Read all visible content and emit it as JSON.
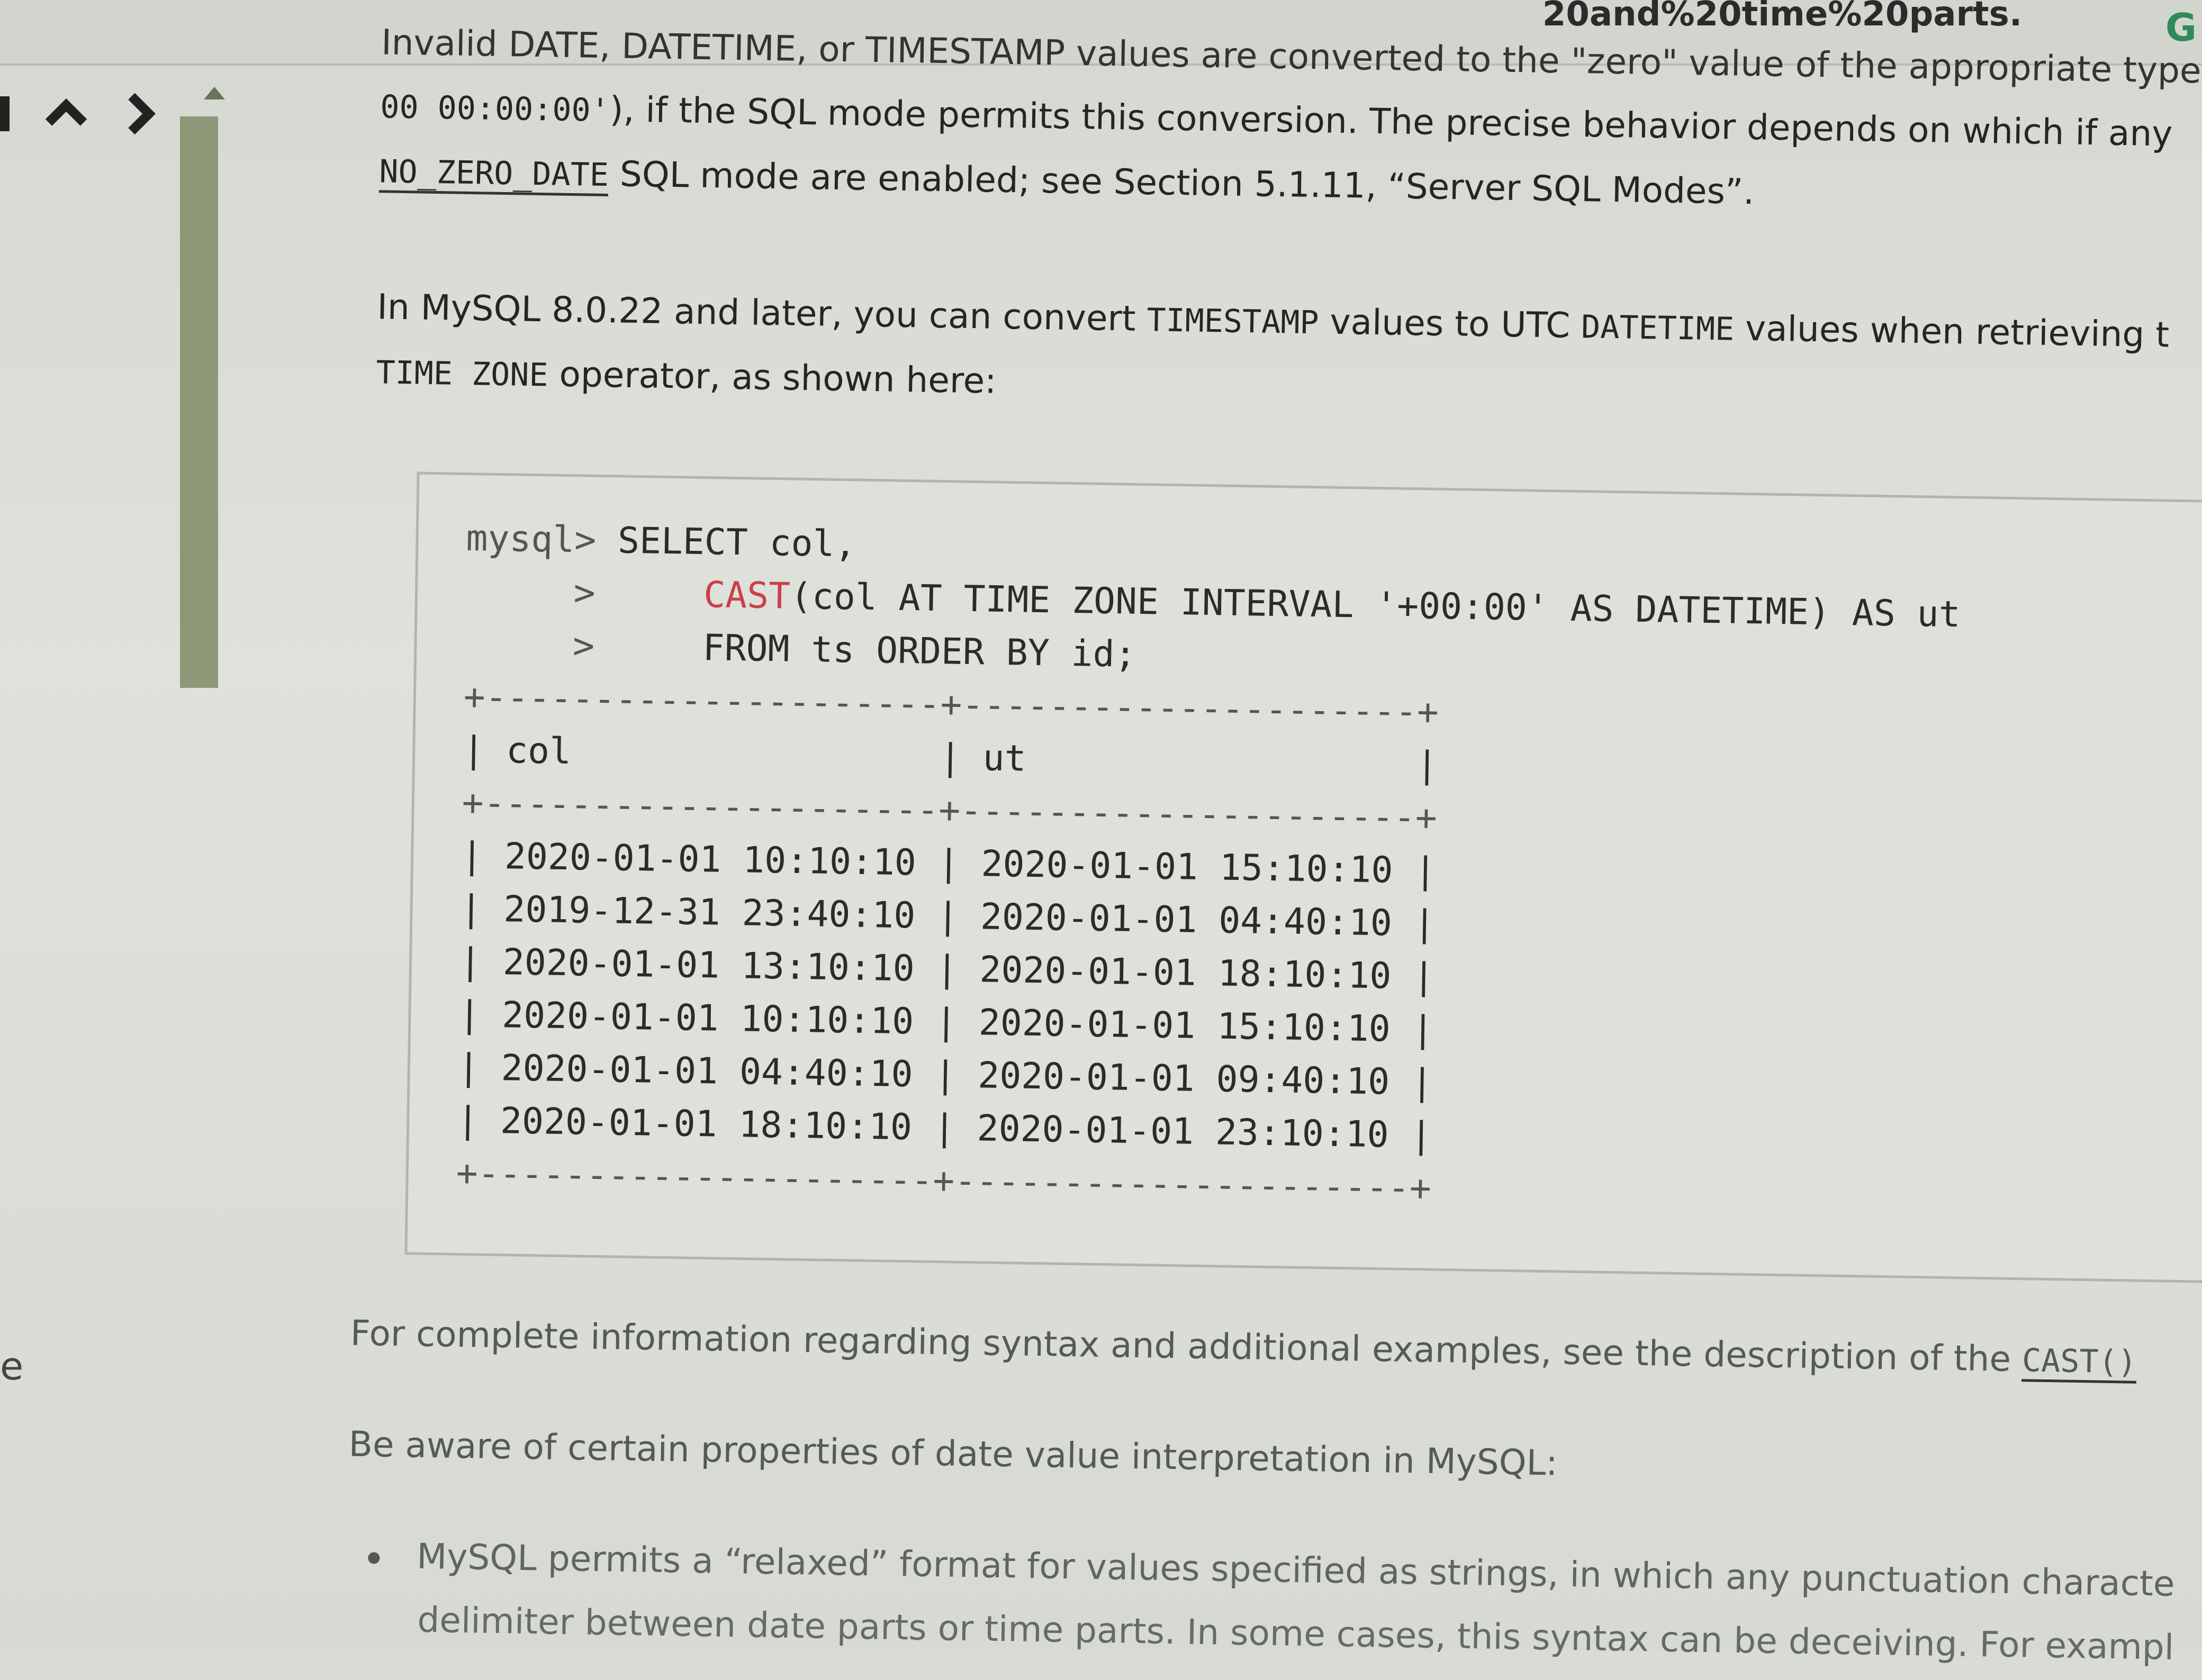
{
  "browser": {
    "url_fragment": "20and%20time%20parts.",
    "extension_label": "G"
  },
  "navigation": {
    "edge_label": "e"
  },
  "doc": {
    "para1_line1": "Invalid DATE, DATETIME, or TIMESTAMP values are converted to the \"zero\" value of the appropriate type (",
    "para1_line2_code": "00 00:00:00'",
    "para1_line2_text": "), if the SQL mode permits this conversion. The precise behavior depends on which if any",
    "para1_line3_link": "NO_ZERO_DATE",
    "para1_line3_text": " SQL mode are enabled; see Section 5.1.11, “Server SQL Modes”.",
    "para2_line1_a": "In MySQL 8.0.22 and later, you can convert ",
    "para2_line1_code1": "TIMESTAMP",
    "para2_line1_b": " values to UTC ",
    "para2_line1_code2": "DATETIME",
    "para2_line1_c": " values when retrieving t",
    "para2_line2_code": "TIME ZONE",
    "para2_line2_text": " operator, as shown here:",
    "code": {
      "prompt": "mysql>",
      "line1": " SELECT col,",
      "cont": "     >     ",
      "cast_kw": "CAST",
      "line2_rest": "(col AT TIME ZONE INTERVAL '+00:00' AS DATETIME) AS ut",
      "line3": "FROM ts ORDER BY id;",
      "separator": "+---------------------+---------------------+",
      "headers": [
        "col",
        "ut"
      ],
      "rows": [
        [
          "2020-01-01 10:10:10",
          "2020-01-01 15:10:10"
        ],
        [
          "2019-12-31 23:40:10",
          "2020-01-01 04:40:10"
        ],
        [
          "2020-01-01 13:10:10",
          "2020-01-01 18:10:10"
        ],
        [
          "2020-01-01 10:10:10",
          "2020-01-01 15:10:10"
        ],
        [
          "2020-01-01 04:40:10",
          "2020-01-01 09:40:10"
        ],
        [
          "2020-01-01 18:10:10",
          "2020-01-01 23:10:10"
        ]
      ]
    },
    "para3_text": "For complete information regarding syntax and additional examples, see the description of the ",
    "para3_link": "CAST()",
    "para4_text": "Be aware of certain properties of date value interpretation in MySQL:",
    "bullet_line1": "MySQL permits a “relaxed” format for values specified as strings, in which any punctuation characte",
    "bullet_line2": "delimiter between date parts or time parts. In some cases, this syntax can be deceiving. For exampl"
  }
}
